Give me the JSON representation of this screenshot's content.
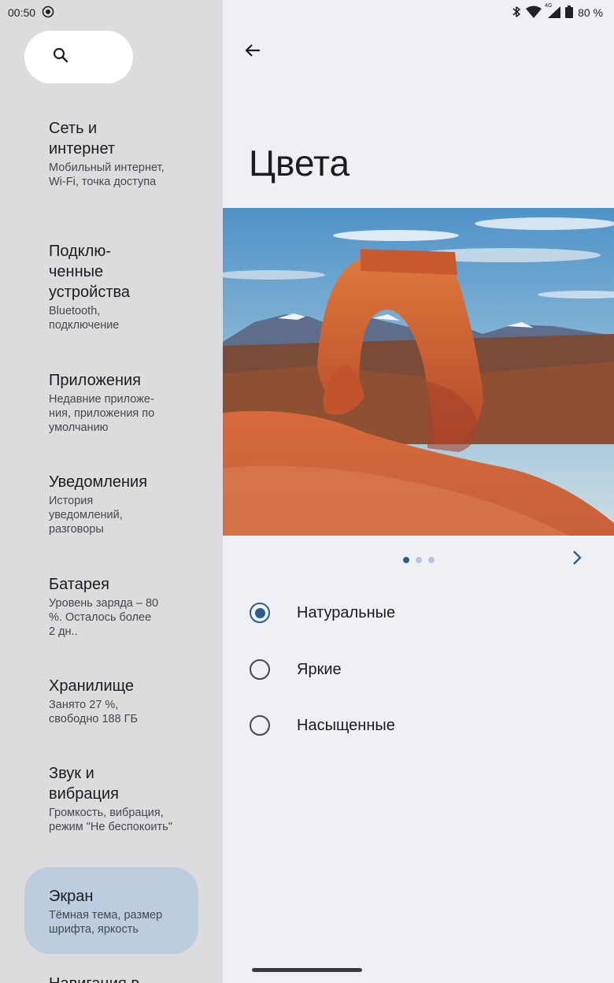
{
  "status": {
    "time": "00:50",
    "battery": "80 %",
    "network": "4G"
  },
  "sidebar": {
    "search_icon": "search-icon",
    "items": [
      {
        "title": "Сеть и интернет",
        "subtitle": "Мобильный интернет, Wi-Fi, точка доступа"
      },
      {
        "title": "Подклю-ченные устройства",
        "subtitle": "Bluetooth, подключение"
      },
      {
        "title": "Приложения",
        "subtitle": "Недавние приложе-ния, приложения по умолчанию"
      },
      {
        "title": "Уведомления",
        "subtitle": "История уведомлений, разговоры"
      },
      {
        "title": "Батарея",
        "subtitle": "Уровень заряда – 80 %. Осталось более 2 дн.."
      },
      {
        "title": "Хранилище",
        "subtitle": "Занято 27 %, свободно 188 ГБ"
      },
      {
        "title": "Звук и вибрация",
        "subtitle": "Громкость, вибрация, режим \"Не беспокоить\""
      },
      {
        "title": "Экран",
        "subtitle": "Тёмная тема, размер шрифта, яркость"
      },
      {
        "title": "Навигация в",
        "subtitle": ""
      }
    ]
  },
  "main": {
    "title": "Цвета",
    "carousel": {
      "pages": 3,
      "current": 1
    },
    "options": [
      {
        "label": "Натуральные",
        "selected": true
      },
      {
        "label": "Яркие",
        "selected": false
      },
      {
        "label": "Насыщенные",
        "selected": false
      }
    ]
  },
  "colors": {
    "accent": "#2e5d8c",
    "active_item_bg": "#bdcde0",
    "sidebar_bg": "#dcdcdf",
    "content_bg": "#eff0f5"
  }
}
